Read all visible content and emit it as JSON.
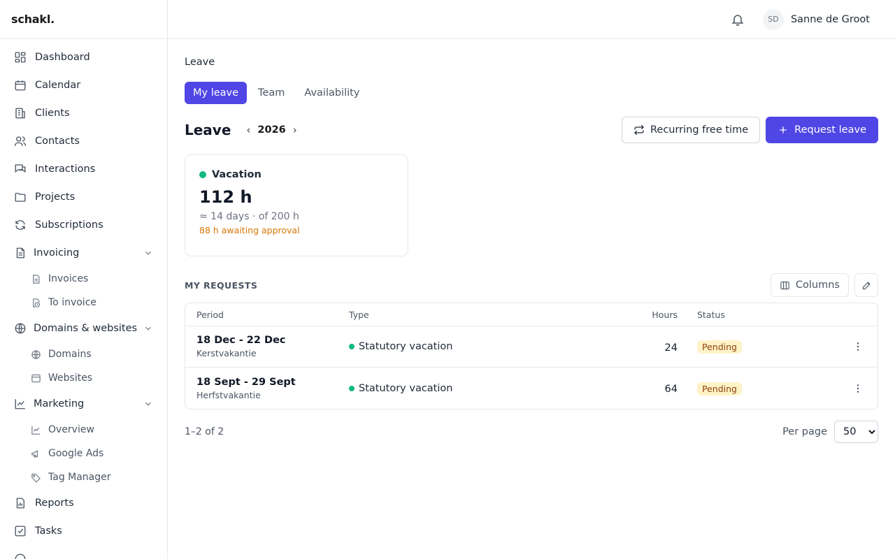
{
  "app": {
    "logo": "schakl."
  },
  "sidebar": {
    "items": [
      {
        "label": "Dashboard",
        "icon": "dashboard-icon"
      },
      {
        "label": "Calendar",
        "icon": "calendar-icon"
      },
      {
        "label": "Clients",
        "icon": "building-icon"
      },
      {
        "label": "Contacts",
        "icon": "users-icon"
      },
      {
        "label": "Interactions",
        "icon": "chat-icon"
      },
      {
        "label": "Projects",
        "icon": "folder-icon"
      },
      {
        "label": "Subscriptions",
        "icon": "refresh-icon"
      }
    ],
    "invoicing": {
      "label": "Invoicing",
      "children": [
        {
          "label": "Invoices"
        },
        {
          "label": "To invoice"
        }
      ]
    },
    "domains": {
      "label": "Domains & websites",
      "children": [
        {
          "label": "Domains"
        },
        {
          "label": "Websites"
        }
      ]
    },
    "marketing": {
      "label": "Marketing",
      "children": [
        {
          "label": "Overview"
        },
        {
          "label": "Google Ads"
        },
        {
          "label": "Tag Manager"
        }
      ]
    },
    "bottom": [
      {
        "label": "Reports"
      },
      {
        "label": "Tasks"
      }
    ]
  },
  "header": {
    "avatar_initials": "SD",
    "user_name": "Sanne de Groot"
  },
  "main": {
    "breadcrumb": "Leave",
    "tabs": [
      {
        "label": "My leave",
        "active": true
      },
      {
        "label": "Team"
      },
      {
        "label": "Availability"
      }
    ],
    "title": "Leave",
    "year": "2026",
    "prev_arrow": "‹",
    "next_arrow": "›",
    "actions": {
      "recurring": "Recurring free time",
      "request": "Request leave"
    },
    "balance_card": {
      "label": "Vacation",
      "hours": "112 h",
      "sub": "≈ 14 days · of 200 h",
      "awaiting": "88 h awaiting approval",
      "color": "#10b981"
    },
    "requests": {
      "title": "MY REQUESTS",
      "columns_button": "Columns",
      "headers": {
        "period": "Period",
        "type": "Type",
        "hours": "Hours",
        "status": "Status"
      },
      "rows": [
        {
          "period": "18 Dec - 22 Dec",
          "note": "Kerstvakantie",
          "type": "Statutory vacation",
          "hours": "24",
          "status": "Pending"
        },
        {
          "period": "18 Sept - 29 Sept",
          "note": "Herfstvakantie",
          "type": "Statutory vacation",
          "hours": "64",
          "status": "Pending"
        }
      ],
      "range": "1–2 of 2",
      "per_page_label": "Per page",
      "per_page_value": "50"
    }
  }
}
